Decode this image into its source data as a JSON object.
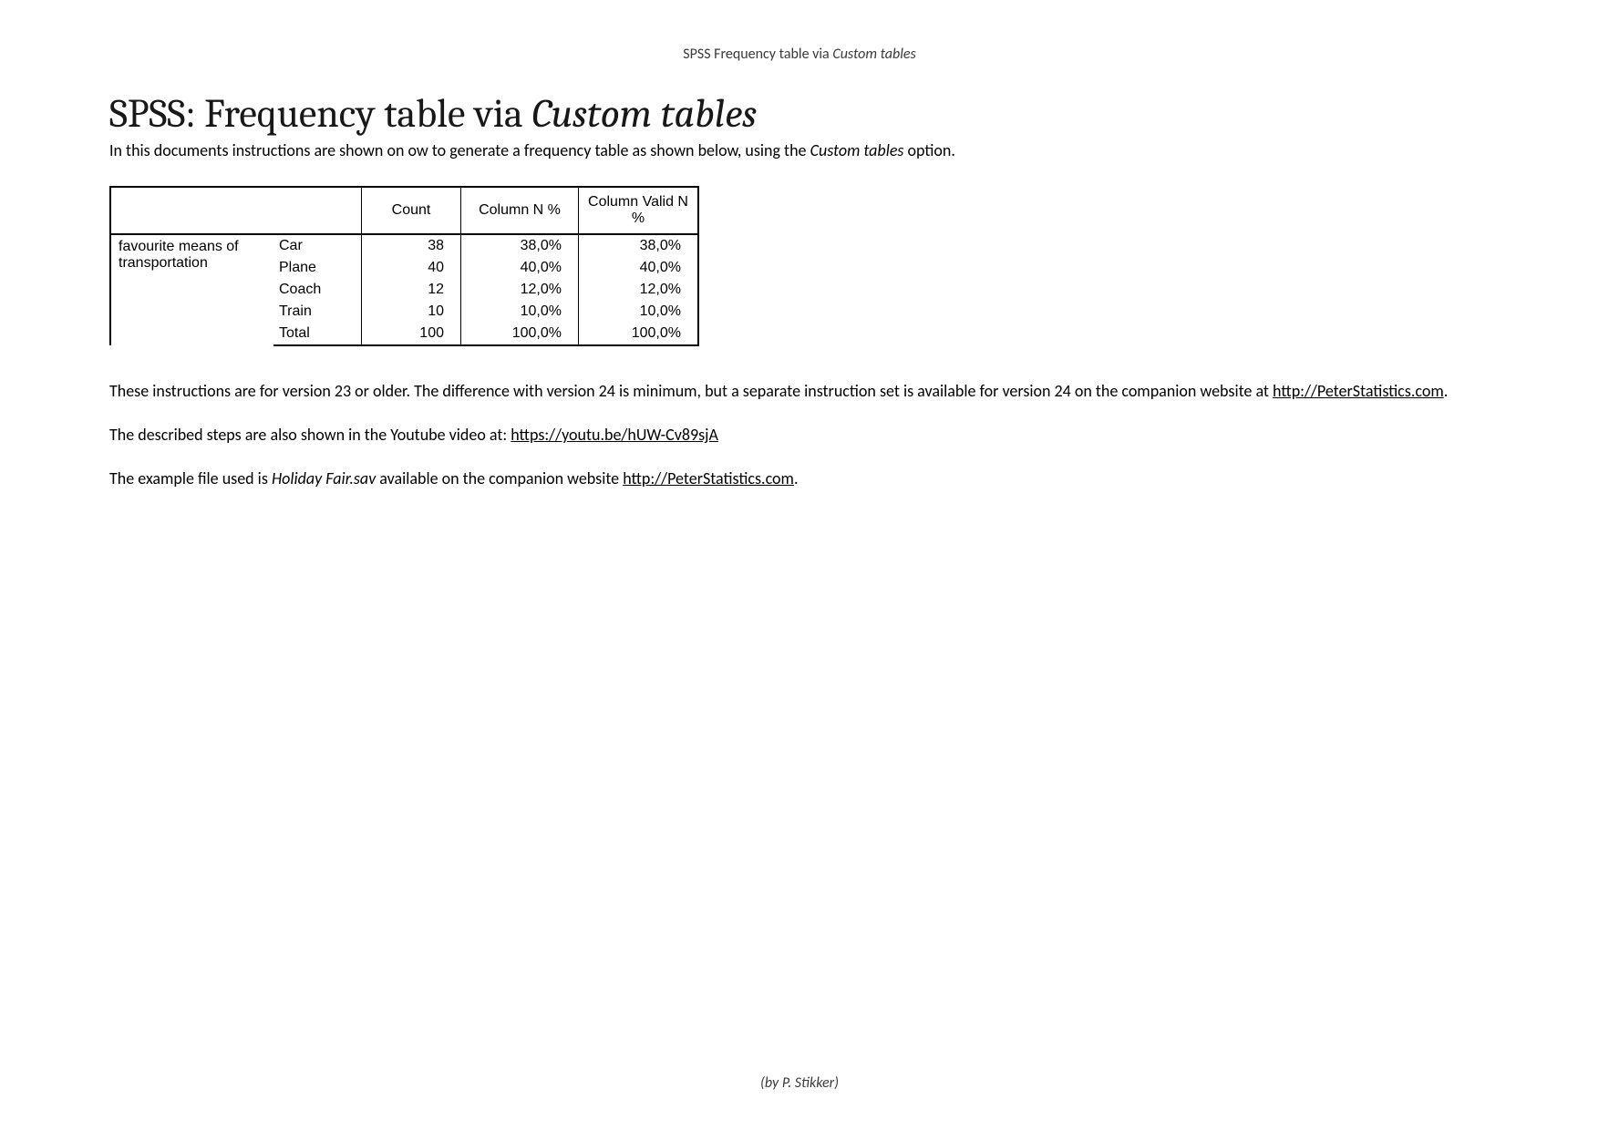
{
  "header": {
    "prefix": "SPSS Frequency table via ",
    "italic": "Custom tables"
  },
  "title": {
    "prefix": "SPSS: Frequency table via ",
    "italic": "Custom tables"
  },
  "intro": {
    "before": "In this documents instructions are shown on ow to generate a frequency table as shown below, using the ",
    "italic": "Custom tables",
    "after": " option."
  },
  "table": {
    "row_header": "favourite means of transportation",
    "columns": [
      "Count",
      "Column N %",
      "Column Valid N %"
    ],
    "rows": [
      {
        "label": "Car",
        "count": "38",
        "pct": "38,0%",
        "valid": "38,0%"
      },
      {
        "label": "Plane",
        "count": "40",
        "pct": "40,0%",
        "valid": "40,0%"
      },
      {
        "label": "Coach",
        "count": "12",
        "pct": "12,0%",
        "valid": "12,0%"
      },
      {
        "label": "Train",
        "count": "10",
        "pct": "10,0%",
        "valid": "10,0%"
      },
      {
        "label": "Total",
        "count": "100",
        "pct": "100,0%",
        "valid": "100,0%"
      }
    ]
  },
  "p1": {
    "before": "These instructions are for version 23 or older. The difference with version 24 is minimum, but a separate instruction set is available for version 24 on the companion website at ",
    "link": "http://PeterStatistics.com",
    "after": "."
  },
  "p2": {
    "before": "The described steps are also shown in the Youtube video at: ",
    "link": "https://youtu.be/hUW-Cv89sjA"
  },
  "p3": {
    "before": "The example file used is ",
    "italic": "Holiday Fair.sav",
    "mid": " available on the companion website ",
    "link": "http://PeterStatistics.com",
    "after": "."
  },
  "footer": "(by P. Stikker)"
}
